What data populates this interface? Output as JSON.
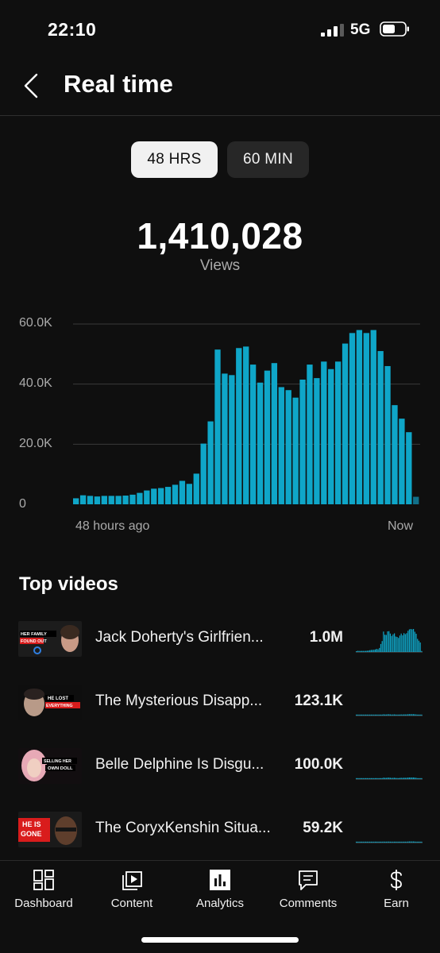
{
  "status_bar": {
    "time": "22:10",
    "network": "5G"
  },
  "header": {
    "title": "Real time"
  },
  "toggle": {
    "active": "48 HRS",
    "inactive": "60 MIN"
  },
  "summary": {
    "total": "1,410,028",
    "label": "Views"
  },
  "chart_data": {
    "type": "bar",
    "ylim": [
      0,
      60000
    ],
    "y_ticks": [
      "60.0K",
      "40.0K",
      "20.0K",
      "0"
    ],
    "x_labels": {
      "start": "48 hours ago",
      "end": "Now"
    },
    "grid": true,
    "color": "#0fa6c8",
    "last_bar_color": "#11708a",
    "values": [
      2000,
      3000,
      2800,
      2600,
      2800,
      2800,
      2800,
      2900,
      3200,
      3800,
      4600,
      5200,
      5400,
      5800,
      6500,
      7800,
      6800,
      10200,
      20200,
      27600,
      51500,
      43500,
      43000,
      52000,
      52500,
      46500,
      40500,
      44500,
      47000,
      39000,
      38000,
      35500,
      41500,
      46500,
      42000,
      47500,
      45000,
      47500,
      53500,
      57000,
      58000,
      57000,
      58000,
      51000,
      46000,
      33000,
      28500,
      24000,
      2500
    ]
  },
  "top_videos": {
    "title": "Top videos",
    "items": [
      {
        "title": "Jack Doherty's Girlfrien...",
        "views": "1.0M",
        "thumb_text": [
          "HER FAMILY",
          "FOUND OUT"
        ]
      },
      {
        "title": "The Mysterious Disapp...",
        "views": "123.1K",
        "thumb_text": [
          "HE LOST",
          "EVERYTHING"
        ]
      },
      {
        "title": "Belle Delphine Is Disgu...",
        "views": "100.0K",
        "thumb_text": [
          "SELLING HER",
          "OWN DOLL"
        ]
      },
      {
        "title": "The CoryxKenshin Situa...",
        "views": "59.2K",
        "thumb_text": [
          "HE IS",
          "GONE"
        ]
      }
    ]
  },
  "bottom_nav": {
    "items": [
      {
        "label": "Dashboard",
        "icon": "dashboard-icon"
      },
      {
        "label": "Content",
        "icon": "content-icon"
      },
      {
        "label": "Analytics",
        "icon": "analytics-icon"
      },
      {
        "label": "Comments",
        "icon": "comments-icon"
      },
      {
        "label": "Earn",
        "icon": "earn-icon"
      }
    ]
  }
}
